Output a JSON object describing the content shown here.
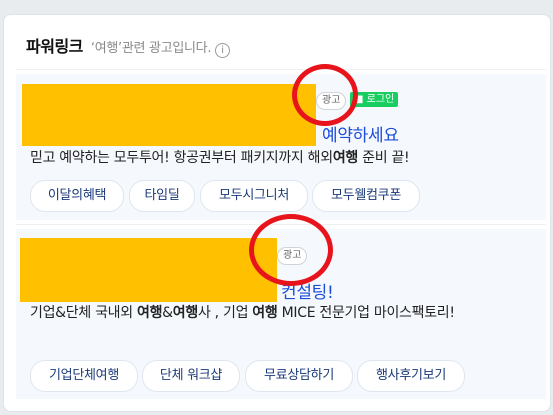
{
  "header": {
    "title": "파워링크",
    "subtitle": "‘여행’관련 광고입니다.",
    "info_icon": "info-icon"
  },
  "ads": [
    {
      "badge": "광고",
      "login_badge": "로그인",
      "title_visible": "예약하세요",
      "description_parts": [
        "믿고 예약하는 모두투어! 항공권부터 패키지까지 해외",
        "여행",
        " 준비 끝!"
      ],
      "chips": [
        "이달의혜택",
        "타임딜",
        "모두시그니처",
        "모두웰컴쿠폰"
      ]
    },
    {
      "badge": "광고",
      "title_visible": "컨설팅!",
      "description_parts": [
        "기업&단체 국내외 ",
        "여행",
        "&",
        "여행",
        "사 , 기업 ",
        "여행",
        " MICE 전문기업 마이스팩토리!"
      ],
      "chips": [
        "기업단체여행",
        "단체 워크샵",
        "무료상담하기",
        "행사후기보기"
      ]
    }
  ],
  "colors": {
    "mask": "#ffc000",
    "annotation_circle": "#e8141c",
    "link": "#1b4dd8",
    "login_badge": "#19ce60"
  }
}
